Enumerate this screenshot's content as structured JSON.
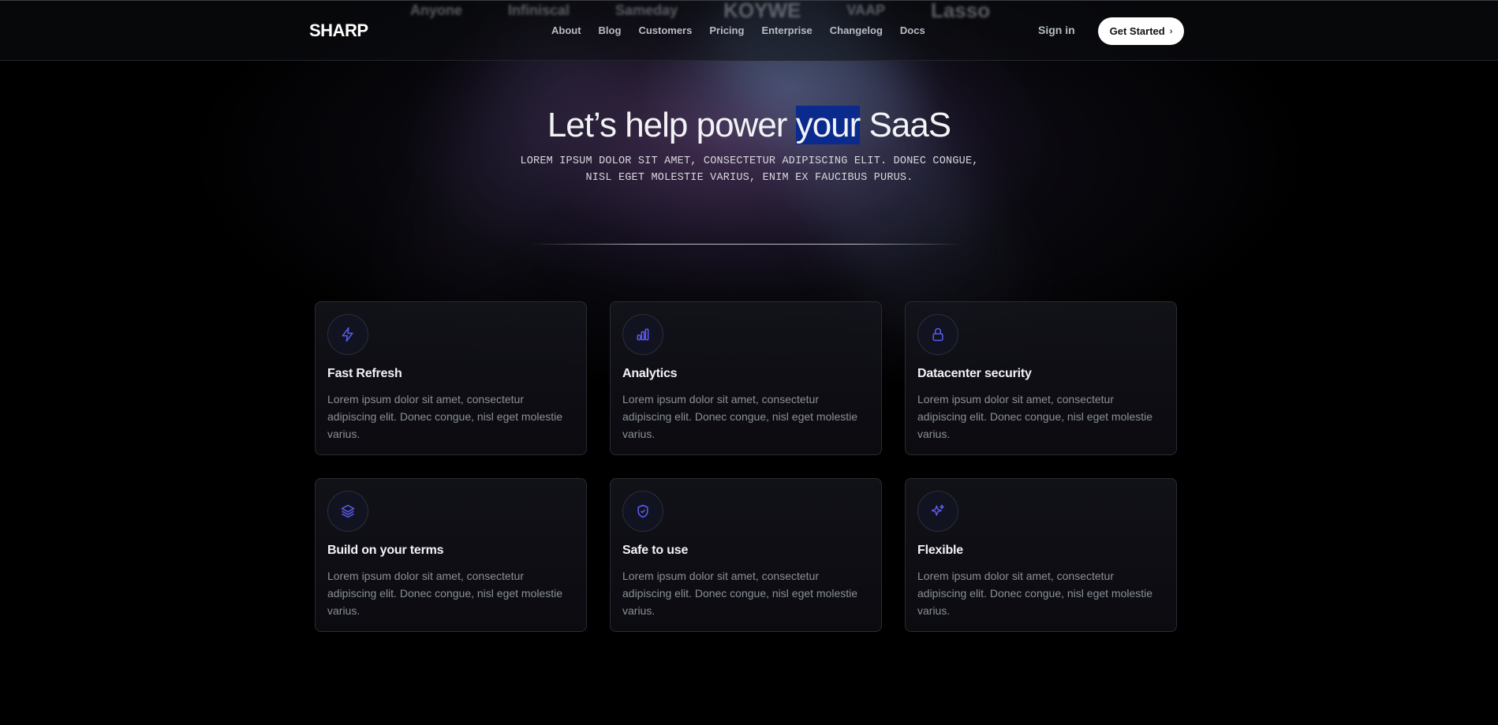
{
  "header": {
    "logos": [
      "Anyone",
      "Infiniscal",
      "Sameday",
      "KOYWE",
      "VAAP",
      "Lasso"
    ],
    "brand": "SHARP",
    "nav": [
      "About",
      "Blog",
      "Customers",
      "Pricing",
      "Enterprise",
      "Changelog",
      "Docs"
    ],
    "signin_label": "Sign in",
    "cta_label": "Get Started",
    "cta_icon": "chevron-right-icon"
  },
  "hero": {
    "title_before": "Let’s help power ",
    "title_highlight": "your",
    "title_after": " SaaS",
    "subtitle": "LOREM IPSUM DOLOR SIT AMET, CONSECTETUR ADIPISCING ELIT. DONEC CONGUE, NISL EGET MOLESTIE VARIUS, ENIM EX FAUCIBUS PURUS."
  },
  "features": [
    {
      "icon": "lightning-icon",
      "title": "Fast Refresh",
      "desc": "Lorem ipsum dolor sit amet, consectetur adipiscing elit. Donec congue, nisl eget molestie varius."
    },
    {
      "icon": "bar-chart-icon",
      "title": "Analytics",
      "desc": "Lorem ipsum dolor sit amet, consectetur adipiscing elit. Donec congue, nisl eget molestie varius."
    },
    {
      "icon": "lock-icon",
      "title": "Datacenter security",
      "desc": "Lorem ipsum dolor sit amet, consectetur adipiscing elit. Donec congue, nisl eget molestie varius."
    },
    {
      "icon": "layers-icon",
      "title": "Build on your terms",
      "desc": "Lorem ipsum dolor sit amet, consectetur adipiscing elit. Donec congue, nisl eget molestie varius."
    },
    {
      "icon": "shield-check-icon",
      "title": "Safe to use",
      "desc": "Lorem ipsum dolor sit amet, consectetur adipiscing elit. Donec congue, nisl eget molestie varius."
    },
    {
      "icon": "sparkles-icon",
      "title": "Flexible",
      "desc": "Lorem ipsum dolor sit amet, consectetur adipiscing elit. Donec congue, nisl eget molestie varius."
    }
  ],
  "colors": {
    "accent_icon": "#5b5cf0",
    "highlight": "#0b2a8e",
    "background": "#000000"
  }
}
